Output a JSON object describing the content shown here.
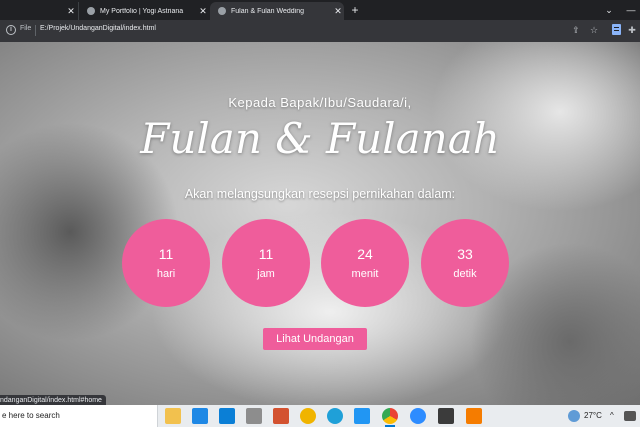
{
  "browser": {
    "tabs": [
      {
        "label": ""
      },
      {
        "label": "My Portfolio | Yogi Astriana"
      },
      {
        "label": "Fulan & Fulan Wedding"
      }
    ],
    "new_tab_label": "+",
    "address": {
      "scheme_label": "File",
      "url": "E:/Projek/UndanganDigital/index.html"
    },
    "status_link": "ndanganDigital/index.html#home"
  },
  "page": {
    "greeting": "Kepada Bapak/Ibu/Saudara/i,",
    "names": "Fulan & Fulanah",
    "subtitle": "Akan melangsungkan resepsi pernikahan dalam:",
    "countdown": [
      {
        "value": "11",
        "unit": "hari"
      },
      {
        "value": "11",
        "unit": "jam"
      },
      {
        "value": "24",
        "unit": "menit"
      },
      {
        "value": "33",
        "unit": "detik"
      }
    ],
    "cta_label": "Lihat Undangan",
    "accent_color": "#ef5d9b"
  },
  "taskbar": {
    "search_placeholder": "e here to search",
    "weather": "27°C",
    "apps": [
      "file-explorer",
      "mail",
      "l-app",
      "media",
      "powerpoint",
      "edge",
      "vscode",
      "chrome",
      "zoom",
      "sublime",
      "xampp"
    ]
  }
}
